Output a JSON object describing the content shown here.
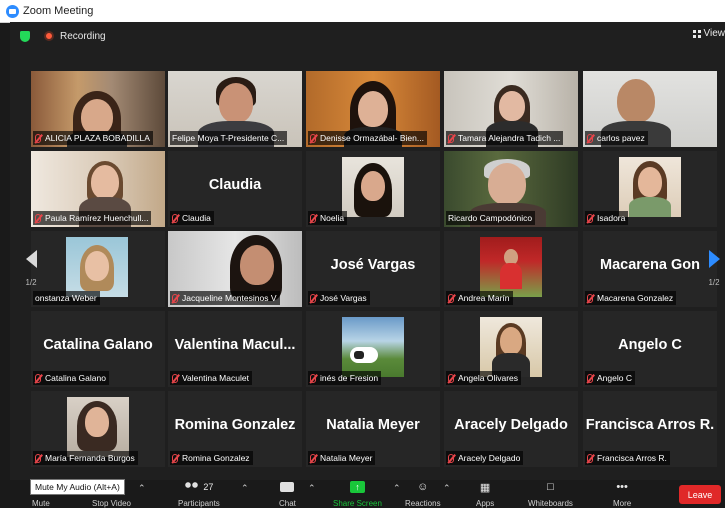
{
  "window": {
    "title": "Zoom Meeting"
  },
  "topbar": {
    "recording_label": "Recording",
    "view_label": "View"
  },
  "pagination": {
    "left": "1/2",
    "right": "1/2"
  },
  "colors": {
    "accent": "#2d8cff",
    "muted_mic": "#e8454a",
    "active_speaker": "#c7e35a",
    "leave": "#e02828",
    "recording": "#ff5b3b"
  },
  "tiles": [
    {
      "name": "ALICIA PLAZA BOBADILLA",
      "big": ""
    },
    {
      "name": "Felipe Moya T-Presidente C...",
      "big": "",
      "active": true
    },
    {
      "name": "Denisse Ormazábal- Bien...",
      "big": ""
    },
    {
      "name": "Tamara Alejandra Tadich ...",
      "big": ""
    },
    {
      "name": "carlos pavez",
      "big": ""
    },
    {
      "name": "Paula Ramírez Huenchull...",
      "big": ""
    },
    {
      "name": "Claudia",
      "big": "Claudia"
    },
    {
      "name": "Noelia",
      "big": ""
    },
    {
      "name": "Ricardo Campodónico",
      "big": ""
    },
    {
      "name": "Isadora",
      "big": ""
    },
    {
      "name": "onstanza Weber",
      "big": ""
    },
    {
      "name": "Jacqueline Montesinos V",
      "big": ""
    },
    {
      "name": "José Vargas",
      "big": "José Vargas"
    },
    {
      "name": "Andrea Marín",
      "big": ""
    },
    {
      "name": "Macarena Gonzalez",
      "big": "Macarena  Gon"
    },
    {
      "name": "Catalina Galano",
      "big": "Catalina Galano"
    },
    {
      "name": "Valentina Maculet",
      "big": "Valentina  Macul..."
    },
    {
      "name": "inés de Fresion",
      "big": ""
    },
    {
      "name": "Angela Olivares",
      "big": ""
    },
    {
      "name": "Angelo C",
      "big": "Angelo C"
    },
    {
      "name": "María Fernanda Burgos",
      "big": ""
    },
    {
      "name": "Romina Gonzalez",
      "big": "Romina Gonzalez"
    },
    {
      "name": "Natalia Meyer",
      "big": "Natalia Meyer"
    },
    {
      "name": "Aracely Delgado",
      "big": "Aracely Delgado"
    },
    {
      "name": "Francisca Arros R.",
      "big": "Francisca Arros R."
    }
  ],
  "toolbar": {
    "tooltip": "Mute My Audio (Alt+A)",
    "mute": "Mute",
    "stop_video": "Stop Video",
    "participants": "Participants",
    "participants_count": "27",
    "chat": "Chat",
    "share": "Share Screen",
    "reactions": "Reactions",
    "apps": "Apps",
    "whiteboards": "Whiteboards",
    "more": "More",
    "leave": "Leave"
  }
}
